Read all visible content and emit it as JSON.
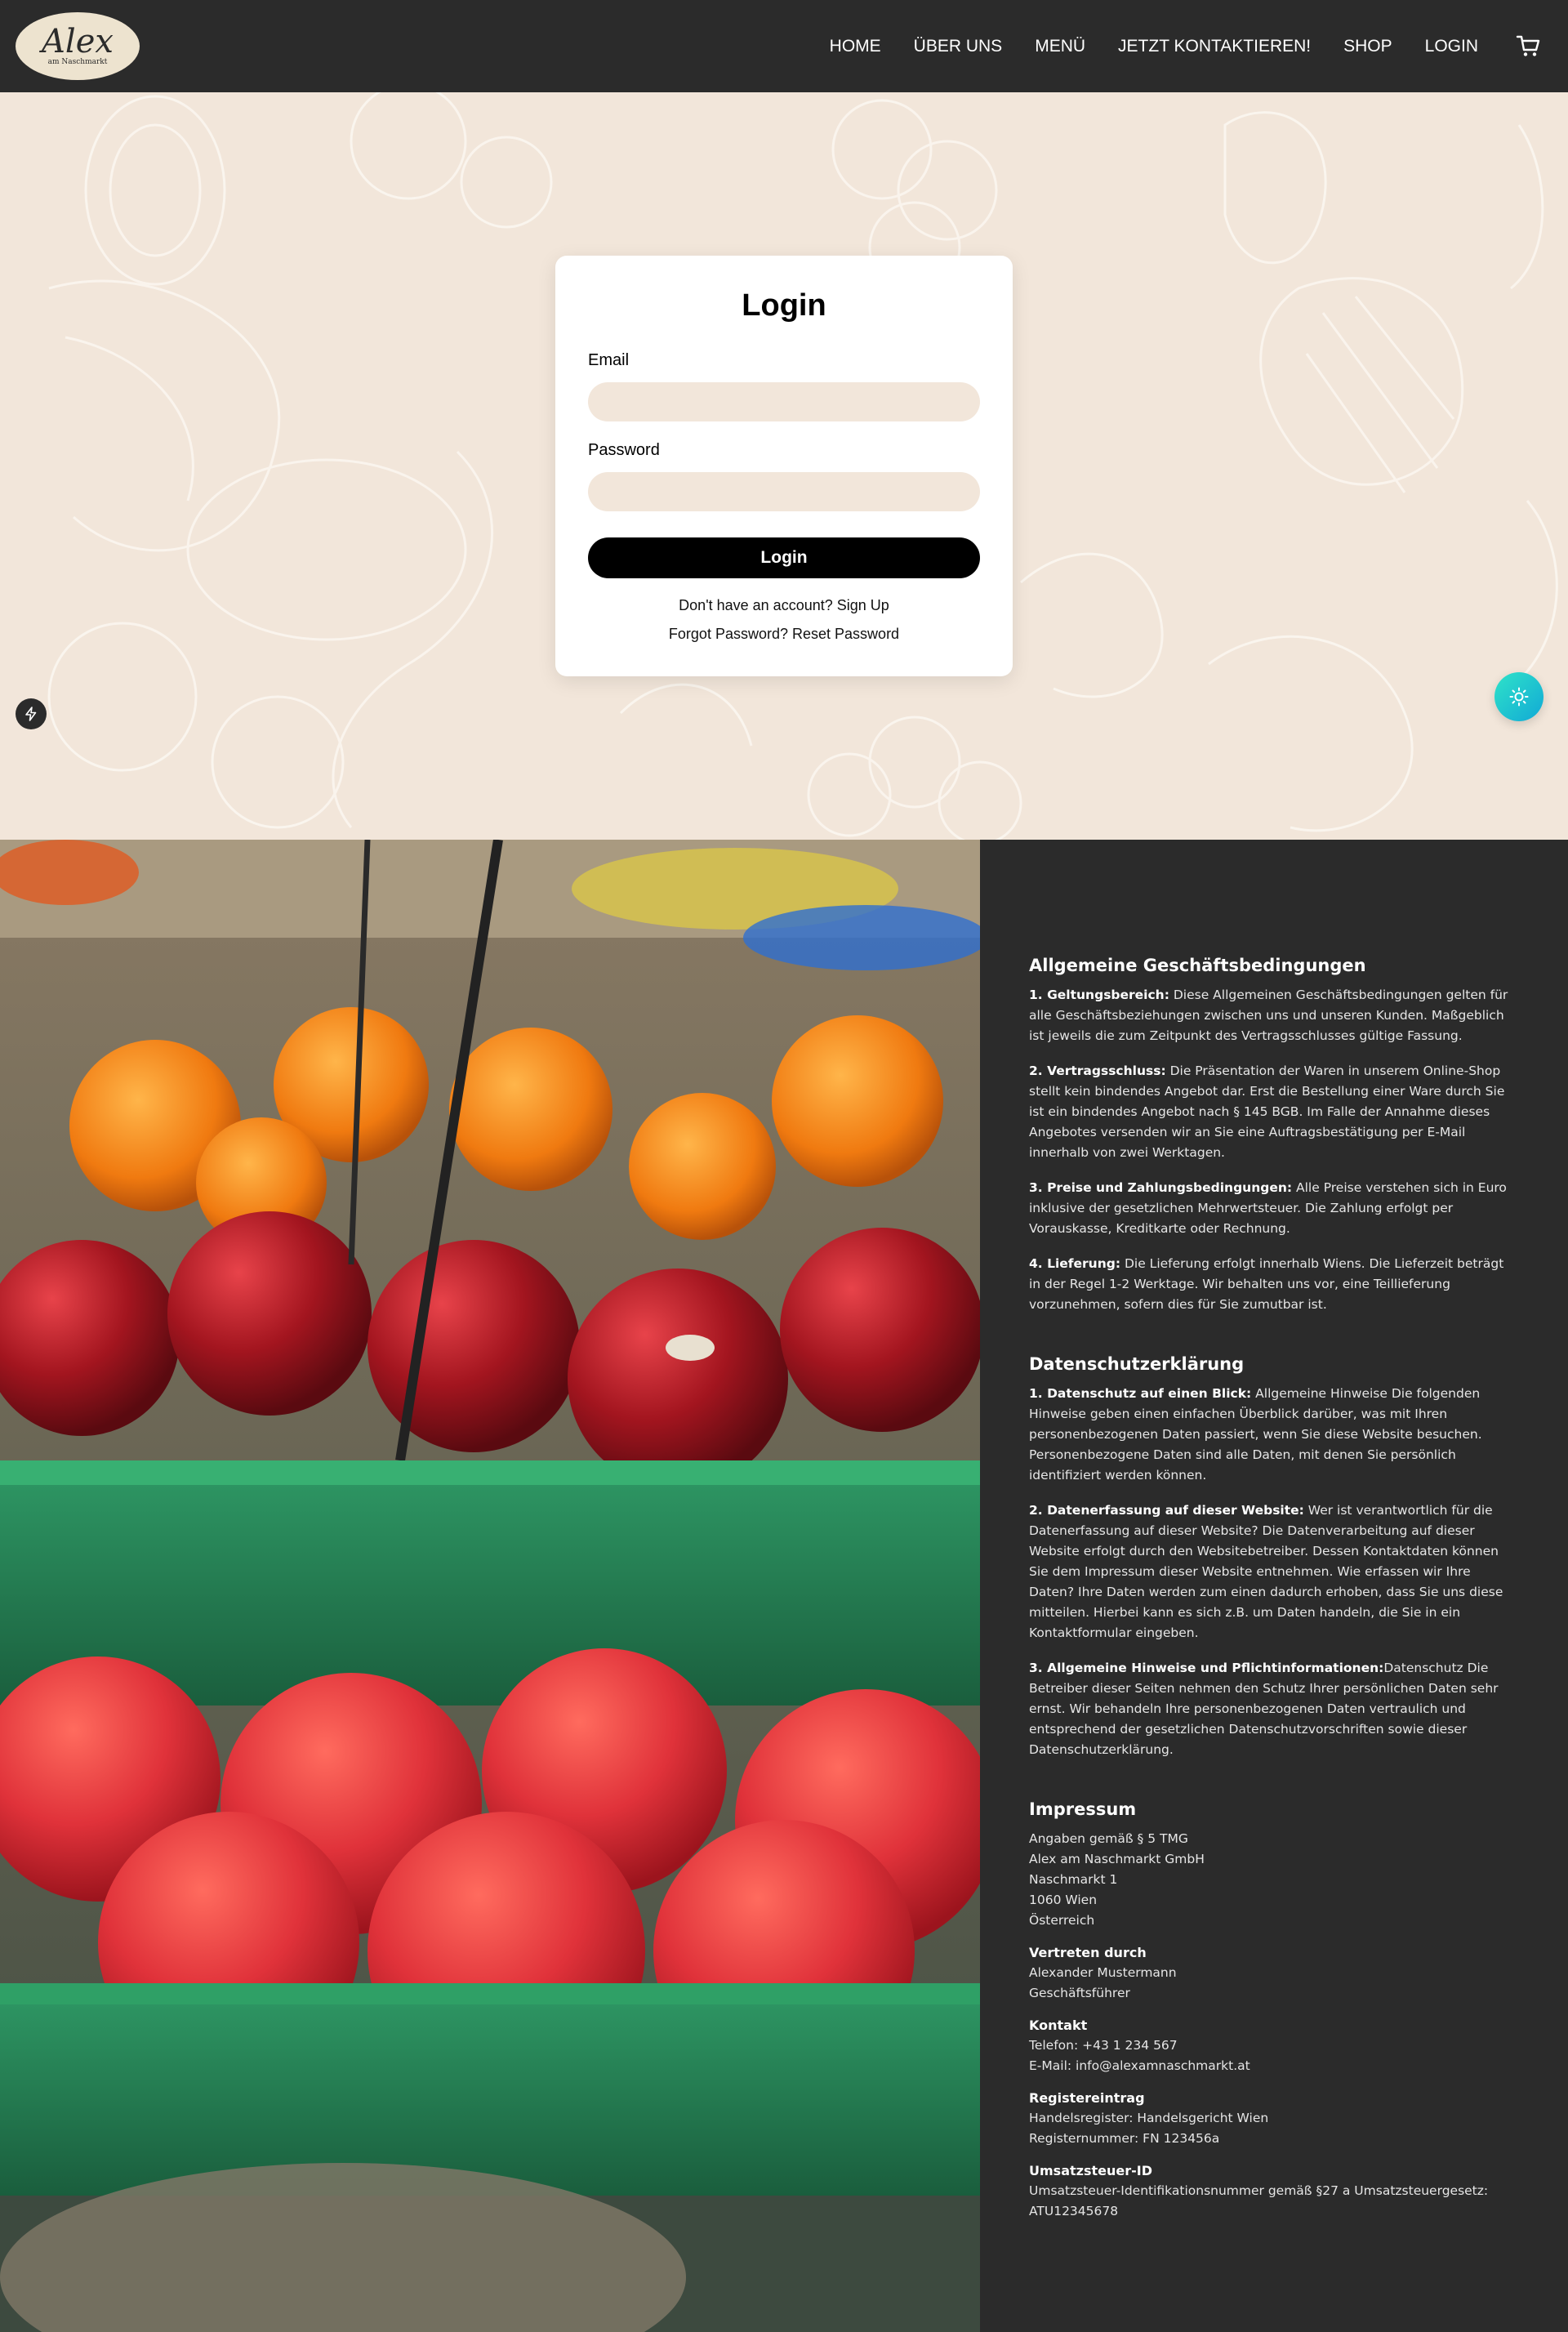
{
  "nav": {
    "logo_text": "Alex",
    "logo_sub": "am Naschmarkt",
    "links": [
      "HOME",
      "ÜBER UNS",
      "MENÜ",
      "JETZT KONTAKTIEREN!",
      "SHOP",
      "LOGIN"
    ],
    "cart_icon": "cart-icon"
  },
  "login": {
    "title": "Login",
    "email_label": "Email",
    "email_value": "",
    "password_label": "Password",
    "password_value": "",
    "button": "Login",
    "signup_prompt": "Don't have an account?",
    "signup_link": "Sign Up",
    "forgot_prompt": "Forgot Password?",
    "reset_link": "Reset Password"
  },
  "colors": {
    "dark": "#2b2b2b",
    "cream": "#f2e6da",
    "accent_teal": "#1fc8d0"
  },
  "agb": {
    "title": "Allgemeine Geschäftsbedingungen",
    "items": [
      {
        "head": "1. Geltungsbereich:",
        "text": " Diese Allgemeinen Geschäftsbedingungen gelten für alle Geschäftsbeziehungen zwischen uns und unseren Kunden. Maßgeblich ist jeweils die zum Zeitpunkt des Vertragsschlusses gültige Fassung."
      },
      {
        "head": "2. Vertragsschluss:",
        "text": " Die Präsentation der Waren in unserem Online-Shop stellt kein bindendes Angebot dar. Erst die Bestellung einer Ware durch Sie ist ein bindendes Angebot nach § 145 BGB. Im Falle der Annahme dieses Angebotes versenden wir an Sie eine Auftragsbestätigung per E-Mail innerhalb von zwei Werktagen."
      },
      {
        "head": "3. Preise und Zahlungsbedingungen:",
        "text": " Alle Preise verstehen sich in Euro inklusive der gesetzlichen Mehrwertsteuer. Die Zahlung erfolgt per Vorauskasse, Kreditkarte oder Rechnung."
      },
      {
        "head": "4. Lieferung:",
        "text": " Die Lieferung erfolgt innerhalb Wiens. Die Lieferzeit beträgt in der Regel 1-2 Werktage. Wir behalten uns vor, eine Teillieferung vorzunehmen, sofern dies für Sie zumutbar ist."
      }
    ]
  },
  "privacy": {
    "title": "Datenschutzerklärung",
    "items": [
      {
        "head": "1. Datenschutz auf einen Blick:",
        "text": " Allgemeine Hinweise Die folgenden Hinweise geben einen einfachen Überblick darüber, was mit Ihren personenbezogenen Daten passiert, wenn Sie diese Website besuchen. Personenbezogene Daten sind alle Daten, mit denen Sie persönlich identifiziert werden können."
      },
      {
        "head": "2. Datenerfassung auf dieser Website:",
        "text": " Wer ist verantwortlich für die Datenerfassung auf dieser Website? Die Datenverarbeitung auf dieser Website erfolgt durch den Websitebetreiber. Dessen Kontaktdaten können Sie dem Impressum dieser Website entnehmen. Wie erfassen wir Ihre Daten? Ihre Daten werden zum einen dadurch erhoben, dass Sie uns diese mitteilen. Hierbei kann es sich z.B. um Daten handeln, die Sie in ein Kontaktformular eingeben."
      },
      {
        "head": "3. Allgemeine Hinweise und Pflichtinformationen:",
        "text": "Datenschutz Die Betreiber dieser Seiten nehmen den Schutz Ihrer persönlichen Daten sehr ernst. Wir behandeln Ihre personenbezogenen Daten vertraulich und entsprechend der gesetzlichen Datenschutzvorschriften sowie dieser Datenschutzerklärung."
      }
    ]
  },
  "impressum": {
    "title": "Impressum",
    "lines": [
      "Angaben gemäß § 5 TMG",
      "Alex am Naschmarkt GmbH",
      "Naschmarkt 1",
      "1060 Wien",
      "Österreich"
    ],
    "rep_head": "Vertreten durch",
    "rep_lines": [
      "Alexander Mustermann",
      "Geschäftsführer"
    ],
    "contact_head": "Kontakt",
    "contact_lines": [
      "Telefon: +43 1 234 567",
      "E-Mail: info@alexamnaschmarkt.at"
    ],
    "register_head": "Registereintrag",
    "register_lines": [
      "Handelsregister: Handelsgericht Wien",
      "Registernummer: FN 123456a"
    ],
    "vat_head": "Umsatzsteuer-ID",
    "vat_lines": [
      "Umsatzsteuer-Identifikationsnummer gemäß §27 a Umsatzsteuergesetz:",
      "ATU12345678"
    ]
  }
}
